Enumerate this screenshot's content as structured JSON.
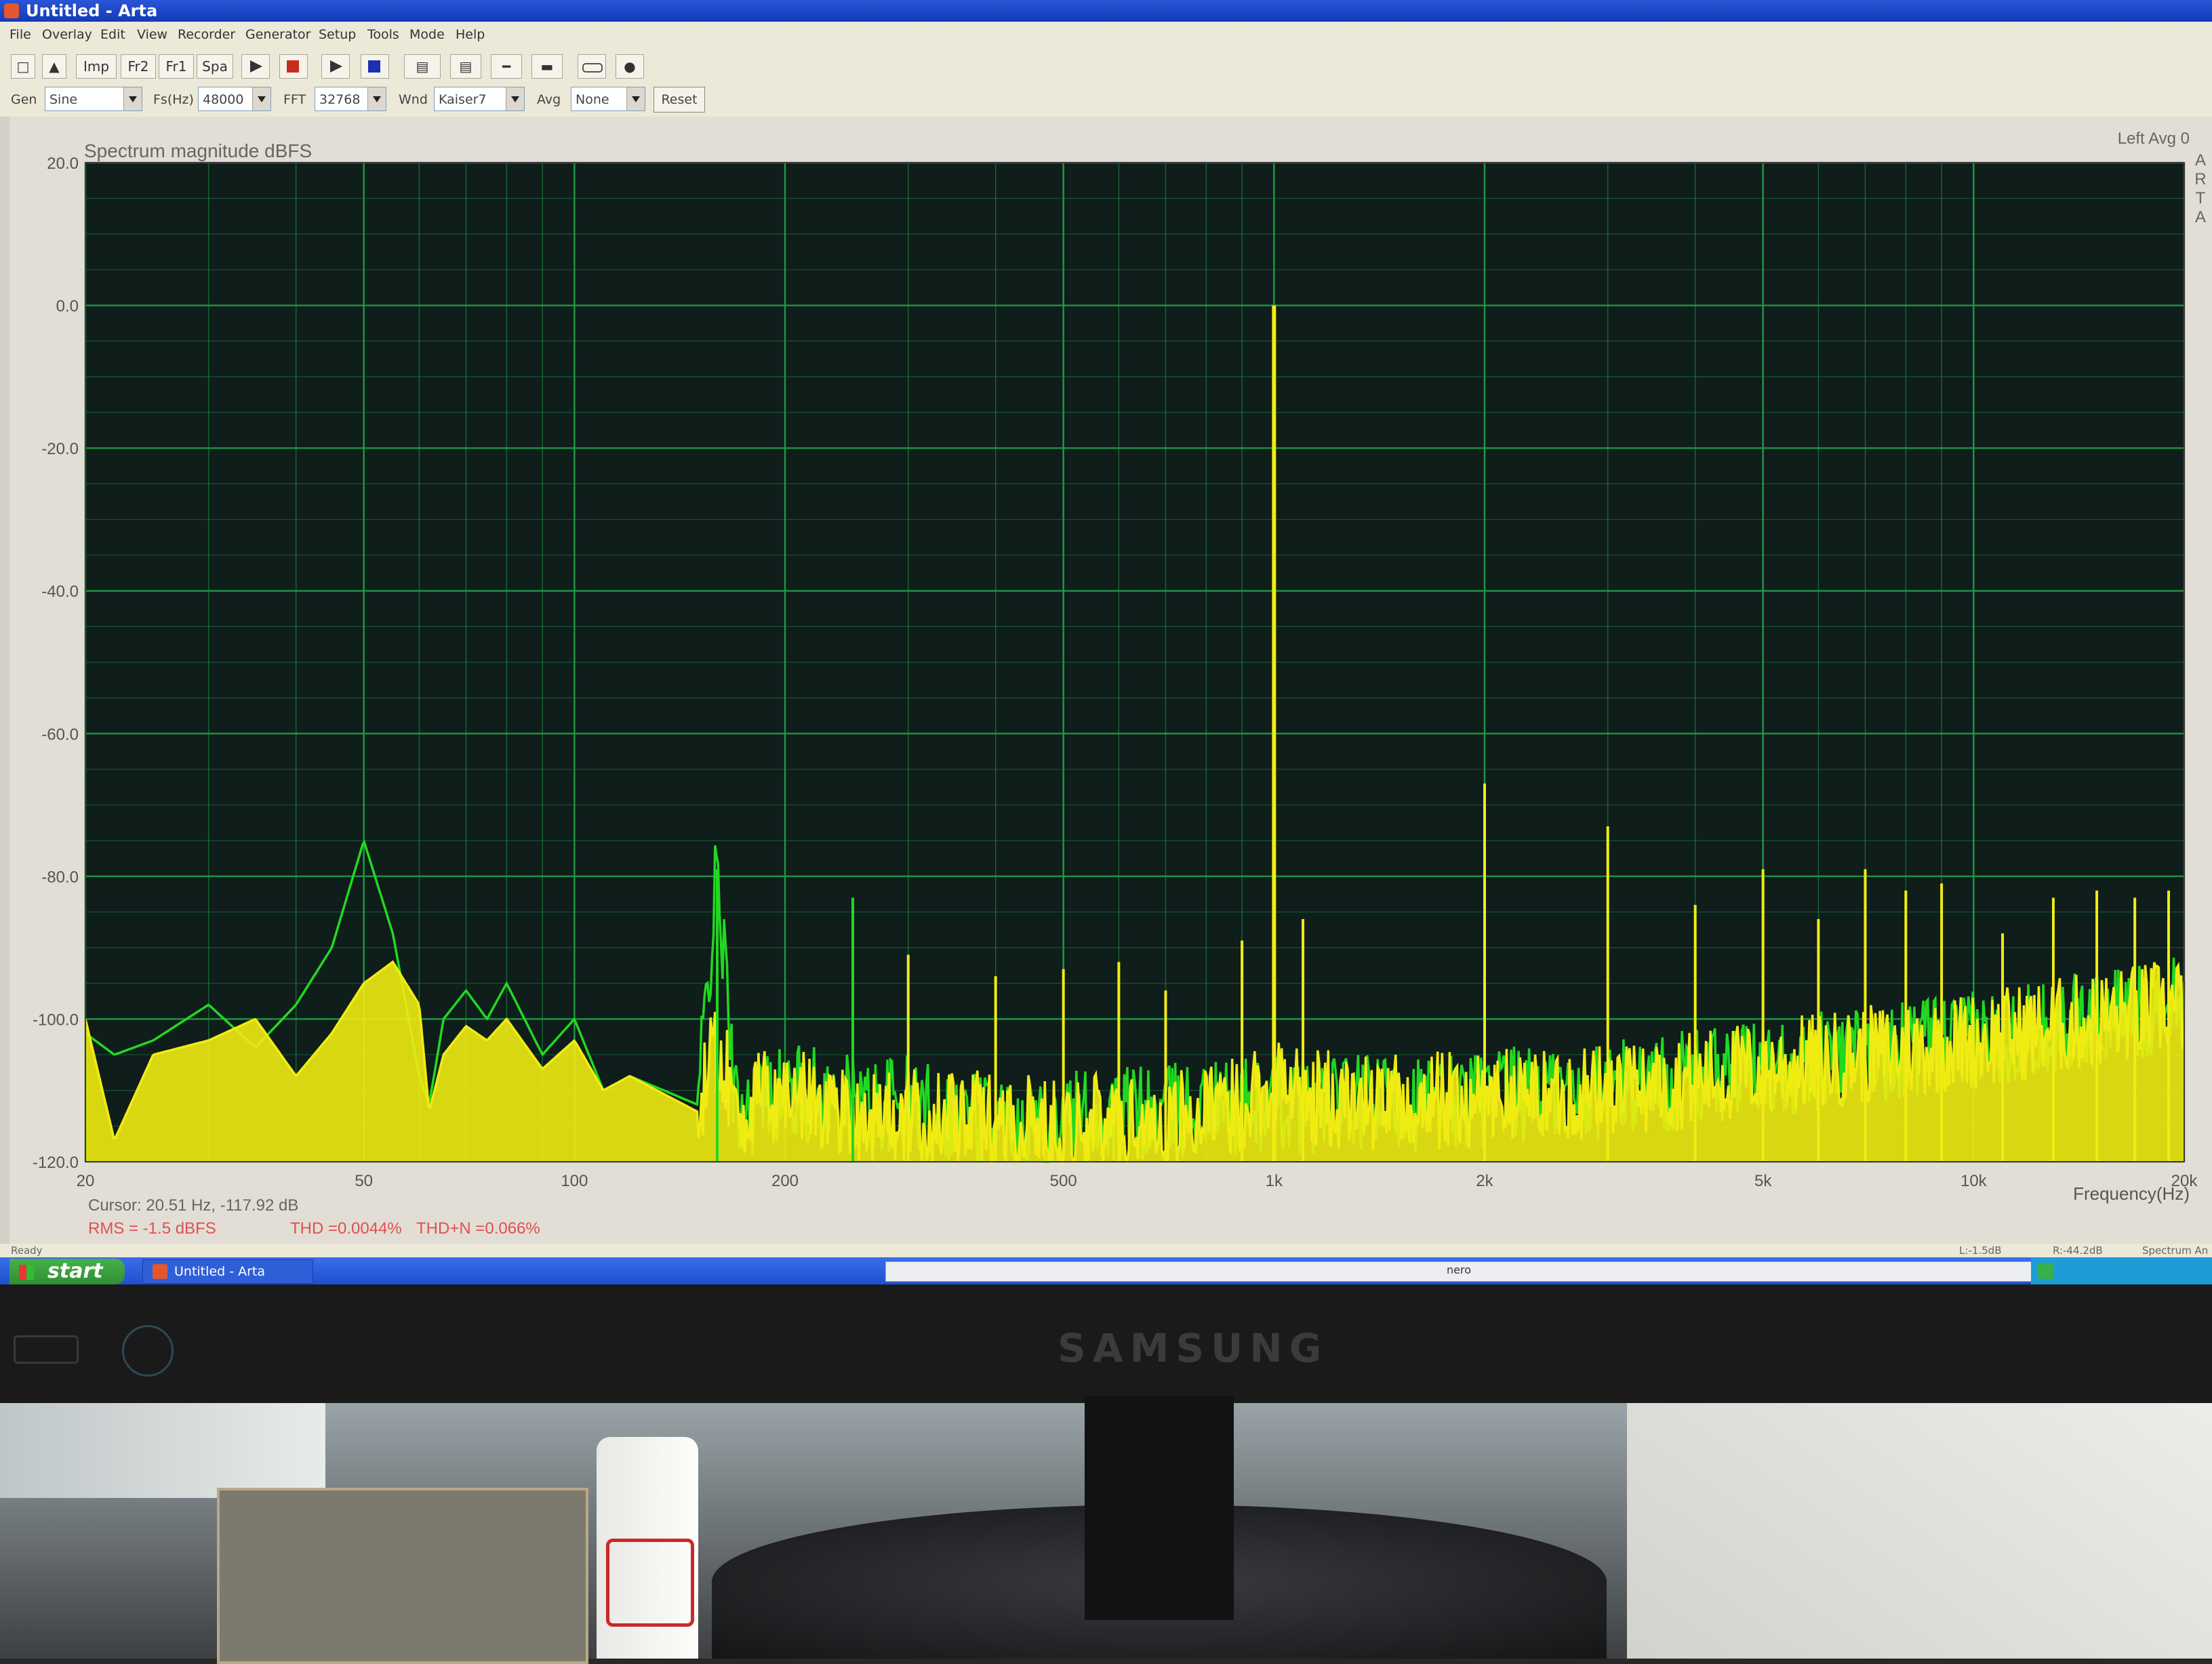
{
  "window": {
    "title": "Untitled - Arta"
  },
  "menu": [
    "File",
    "Overlay",
    "Edit",
    "View",
    "Recorder",
    "Generator",
    "Setup",
    "Tools",
    "Mode",
    "Help"
  ],
  "toolbar": [
    "Imp",
    "Fr2",
    "Fr1",
    "Spa"
  ],
  "controls": {
    "gen_label": "Gen",
    "gen_value": "Sine",
    "fs_label": "Fs(Hz)",
    "fs_value": "48000",
    "fft_label": "FFT",
    "fft_value": "32768",
    "wnd_label": "Wnd",
    "wnd_value": "Kaiser7",
    "avg_label": "Avg",
    "avg_value": "None",
    "reset": "Reset"
  },
  "plot": {
    "cursor": "Cursor: 20.51 Hz, -117.92 dB",
    "rms": "RMS =   -1.5 dBFS",
    "thd": "THD =0.0044%",
    "thdn": "THD+N =0.066%",
    "side_letters": "ARTA"
  },
  "status": {
    "ready": "Ready",
    "left_level": "L:-1.5dB",
    "right_level": "R:-44.2dB",
    "mode": "Spectrum An"
  },
  "taskbar": {
    "start": "start",
    "task": "Untitled - Arta",
    "nero": "nero"
  },
  "monitor": {
    "brand": "SAMSUNG"
  },
  "colors": {
    "plot_bg": "#0f1d1b",
    "grid": "#1f9e46",
    "trace_left": "#f0ec12",
    "trace_right": "#22d821",
    "title_bar": "#1744c8"
  },
  "chart_data": {
    "type": "line",
    "title": "Spectrum magnitude dBFS",
    "header_right": "Left  Avg 0",
    "xlabel": "Frequency(Hz)",
    "ylabel": "",
    "x_scale": "log",
    "xlim": [
      20,
      20000
    ],
    "ylim": [
      -120,
      20
    ],
    "x_ticks": [
      20,
      50,
      100,
      200,
      500,
      1000,
      2000,
      5000,
      10000,
      20000
    ],
    "x_tick_labels": [
      "20",
      "50",
      "100",
      "200",
      "500",
      "1k",
      "2k",
      "5k",
      "10k",
      "20k"
    ],
    "y_ticks": [
      20,
      0,
      -20,
      -40,
      -60,
      -80,
      -100,
      -120
    ],
    "y_tick_labels": [
      "20.0",
      "0.0",
      "-20.0",
      "-40.0",
      "-60.0",
      "-80.0",
      "-100.0",
      "-120.0"
    ],
    "grid": true,
    "series": [
      {
        "color": "#f0ec12",
        "x": [
          20,
          22,
          25,
          30,
          35,
          40,
          45,
          50,
          55,
          60,
          62,
          65,
          70,
          75,
          80,
          90,
          100,
          110,
          120,
          150,
          160,
          170,
          200,
          250,
          300,
          400,
          500,
          700,
          850,
          950,
          1000,
          1100,
          1500,
          2000,
          3000,
          5000,
          10000,
          20000
        ],
        "y": [
          -100,
          -117,
          -105,
          -103,
          -100,
          -108,
          -102,
          -95,
          -92,
          -98,
          -113,
          -105,
          -101,
          -103,
          -100,
          -107,
          -103,
          -110,
          -108,
          -113,
          -103,
          -113,
          -110,
          -113,
          -114,
          -114,
          -115,
          -114,
          -113,
          -110,
          -108,
          -111,
          -112,
          -111,
          -110,
          -107,
          -103,
          -98
        ]
      },
      {
        "color": "#22d821",
        "x": [
          20,
          22,
          25,
          30,
          35,
          40,
          45,
          50,
          55,
          60,
          62,
          65,
          70,
          75,
          80,
          90,
          100,
          110,
          120,
          150,
          160,
          170,
          200,
          250,
          300,
          400,
          500,
          700,
          1000,
          1500,
          2000,
          3000,
          5000,
          10000,
          20000
        ],
        "y": [
          -102,
          -105,
          -103,
          -98,
          -104,
          -98,
          -90,
          -75,
          -88,
          -108,
          -112,
          -100,
          -96,
          -100,
          -95,
          -105,
          -100,
          -110,
          -108,
          -112,
          -79,
          -113,
          -110,
          -112,
          -112,
          -114,
          -114,
          -113,
          -112,
          -112,
          -111,
          -110,
          -107,
          -103,
          -98
        ]
      }
    ],
    "spikes": [
      {
        "x": 160,
        "y": -79,
        "color": "#22d821"
      },
      {
        "x": 250,
        "y": -83,
        "color": "#22d821"
      },
      {
        "x": 300,
        "y": -91,
        "color": "#f0ec12"
      },
      {
        "x": 400,
        "y": -94,
        "color": "#f0ec12"
      },
      {
        "x": 500,
        "y": -93,
        "color": "#f0ec12"
      },
      {
        "x": 600,
        "y": -92,
        "color": "#f0ec12"
      },
      {
        "x": 700,
        "y": -96,
        "color": "#f0ec12"
      },
      {
        "x": 900,
        "y": -89,
        "color": "#f0ec12"
      },
      {
        "x": 1000,
        "y": 0,
        "color": "#f0ec12"
      },
      {
        "x": 1100,
        "y": -86,
        "color": "#f0ec12"
      },
      {
        "x": 2000,
        "y": -67,
        "color": "#f0ec12"
      },
      {
        "x": 3000,
        "y": -73,
        "color": "#f0ec12"
      },
      {
        "x": 4000,
        "y": -84,
        "color": "#f0ec12"
      },
      {
        "x": 5000,
        "y": -79,
        "color": "#f0ec12"
      },
      {
        "x": 6000,
        "y": -86,
        "color": "#f0ec12"
      },
      {
        "x": 7000,
        "y": -79,
        "color": "#f0ec12"
      },
      {
        "x": 8000,
        "y": -82,
        "color": "#f0ec12"
      },
      {
        "x": 9000,
        "y": -81,
        "color": "#f0ec12"
      },
      {
        "x": 11000,
        "y": -88,
        "color": "#f0ec12"
      },
      {
        "x": 13000,
        "y": -83,
        "color": "#f0ec12"
      },
      {
        "x": 15000,
        "y": -82,
        "color": "#f0ec12"
      },
      {
        "x": 17000,
        "y": -83,
        "color": "#f0ec12"
      },
      {
        "x": 19000,
        "y": -82,
        "color": "#f0ec12"
      }
    ]
  }
}
